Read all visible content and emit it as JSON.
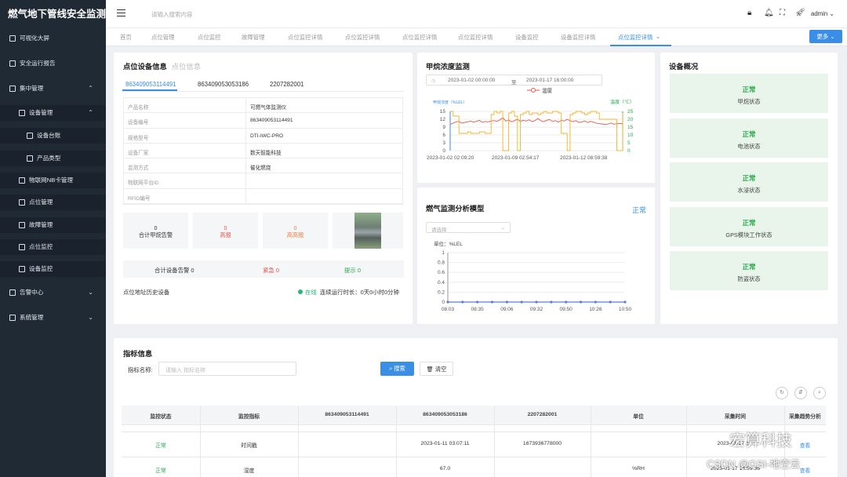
{
  "app": {
    "title": "燃气地下管线安全监测"
  },
  "sidebar": {
    "items": [
      {
        "label": "可视化大屏",
        "icon": "monitor-icon"
      },
      {
        "label": "安全运行报告",
        "icon": "report-icon"
      },
      {
        "label": "集中管理",
        "icon": "sitemap-icon"
      },
      {
        "label": "设备管理",
        "icon": "device-icon"
      },
      {
        "label": "设备台账",
        "icon": "ledger-icon"
      },
      {
        "label": "产品类型",
        "icon": "box-icon"
      },
      {
        "label": "物联网NB卡管理",
        "icon": "card-icon"
      },
      {
        "label": "点位管理",
        "icon": "location-icon"
      },
      {
        "label": "故障管理",
        "icon": "fault-icon"
      },
      {
        "label": "点位监控",
        "icon": "monitor-point-icon"
      },
      {
        "label": "设备监控",
        "icon": "wrench-icon"
      },
      {
        "label": "告警中心",
        "icon": "alarm-icon"
      },
      {
        "label": "系统管理",
        "icon": "gear-icon"
      }
    ]
  },
  "header": {
    "search_placeholder": "请输入搜索内容",
    "user": "admin"
  },
  "tabs": [
    "首页",
    "点位管理",
    "点位监控",
    "故障管理",
    "点位监控详情",
    "点位监控详情",
    "点位监控详情",
    "点位监控详情",
    "设备监控",
    "设备监控详情",
    "点位监控详情"
  ],
  "more_label": "更多",
  "device": {
    "title": "点位设备信息",
    "subtitle": "点位信息",
    "tabs": [
      "863409053114491",
      "863409053053186",
      "2207282001"
    ],
    "fields": [
      {
        "k": "产品名称",
        "v": "可燃气体监测仪"
      },
      {
        "k": "设备编号",
        "v": "863409053114491"
      },
      {
        "k": "规格型号",
        "v": "DTI-IWC-PRO"
      },
      {
        "k": "设备厂家",
        "v": "数天智能科技"
      },
      {
        "k": "监测方式",
        "v": "催化燃烧"
      },
      {
        "k": "物联网平台ID",
        "v": ""
      },
      {
        "k": "RFID编号",
        "v": ""
      }
    ],
    "stats": [
      {
        "n": "0",
        "label": "合计甲烷告警",
        "color": "#333"
      },
      {
        "n": "0",
        "label": "高报",
        "color": "#e8554e"
      },
      {
        "n": "0",
        "label": "高高报",
        "color": "#f07f3c"
      }
    ],
    "alarm_total": "合计设备告警  0",
    "alarm_urgent": "紧急  0",
    "alarm_tip": "提示  0",
    "history": "点位地址历史设备",
    "online": "在线",
    "runtime": "连续运行时长：0天0小时0分钟"
  },
  "methane": {
    "title": "甲烷浓度监测",
    "start": "2023-01-02 00:00:00",
    "to": "至",
    "end": "2023-01-17 16:00:00",
    "legend": "温度",
    "left_axis": "甲烷浓度（%LEL）",
    "right_axis": "温度（℃）"
  },
  "model": {
    "title": "燃气监测分析模型",
    "status": "正常",
    "select_placeholder": "请选择",
    "unit": "单位：%LEL"
  },
  "overview": {
    "title": "设备概况",
    "items": [
      {
        "s": "正常",
        "l": "甲烷状态"
      },
      {
        "s": "正常",
        "l": "电池状态"
      },
      {
        "s": "正常",
        "l": "水浸状态"
      },
      {
        "s": "正常",
        "l": "GPS模块工作状态"
      },
      {
        "s": "正常",
        "l": "防盗状态"
      }
    ]
  },
  "indicator": {
    "title": "指标信息",
    "label": "指标名称:",
    "placeholder": "请输入 指标名称",
    "search": "搜索",
    "clear": "清空",
    "columns": [
      "监控状态",
      "监控指标",
      "863409053114491",
      "863409053053186",
      "2207282001",
      "单位",
      "采集时间",
      "采集趋势分析"
    ],
    "rows": [
      [
        "正常",
        "时间戳",
        "",
        "2023-01-11 03:07:11",
        "1673936778000",
        "",
        "2023-01-17 1...",
        "查看"
      ],
      [
        "正常",
        "湿度",
        "",
        "67.0",
        "",
        "%RH",
        "2023-01-17 14:59:36",
        "查看"
      ]
    ]
  },
  "watermark": {
    "brand": "宏算科技",
    "csdn": "CSDN @GSI-地空云"
  },
  "chart_data": [
    {
      "type": "line",
      "title": "甲烷浓度监测",
      "x_ticks": [
        "2023-01-02 02:09:20",
        "2023-01-09 02:54:17",
        "2023-01-12 08:59:38"
      ],
      "y_left_ticks": [
        0,
        3,
        6,
        9,
        12,
        15
      ],
      "y_right_ticks": [
        0,
        5,
        10,
        15,
        20,
        25
      ],
      "series": [
        {
          "name": "",
          "axis": "left",
          "color": "#e8554e",
          "values": [
            10,
            10.5,
            11,
            11.2,
            10.5,
            10.8,
            11,
            11.3,
            10.9,
            11.2,
            11.6,
            10.8,
            11.1,
            11,
            11.3,
            11.5,
            11.2,
            11.8,
            12.6,
            11.3,
            11.7,
            11,
            11.5,
            12,
            11.2,
            11.6,
            11.3,
            11.8,
            11.1,
            11.5,
            12.3,
            11.4,
            11.1,
            11.6,
            11.9,
            11.2,
            11.5,
            10.9,
            11.6,
            11.3,
            12,
            11.4,
            11.1,
            11.5,
            10.8,
            10.9,
            11.4,
            10.7,
            11.2,
            10.9,
            10.5,
            10.3,
            10.2,
            10,
            10.2,
            10.6,
            10.1,
            10.3,
            10.4,
            10.2
          ]
        },
        {
          "name": "温度",
          "axis": "right",
          "color": "#f0b429",
          "values": [
            25,
            22,
            22,
            11,
            11,
            11,
            12,
            11,
            11,
            11,
            12,
            12,
            11,
            11,
            23,
            25,
            24,
            25,
            0,
            0,
            24,
            25,
            22,
            0,
            23,
            24,
            25,
            23,
            24,
            24,
            23,
            24,
            25,
            24,
            24,
            25,
            25,
            24,
            11,
            11,
            0,
            23,
            24,
            25,
            25,
            24,
            23,
            24,
            25,
            25,
            24,
            20,
            20,
            20,
            20,
            20,
            20,
            0,
            0,
            24
          ]
        }
      ]
    },
    {
      "type": "line",
      "title": "燃气监测分析模型",
      "categories": [
        "08:03",
        "08:35",
        "09:06",
        "09:32",
        "09:50",
        "10:26",
        "10:50"
      ],
      "ylim": [
        0,
        1
      ],
      "y_ticks": [
        0,
        0.2,
        0.4,
        0.6,
        0.8,
        1
      ],
      "ylabel": "单位：%LEL",
      "series": [
        {
          "name": "",
          "values": [
            0,
            0,
            0,
            0,
            0,
            0,
            0,
            0,
            0,
            0,
            0,
            0,
            0
          ]
        }
      ]
    }
  ]
}
